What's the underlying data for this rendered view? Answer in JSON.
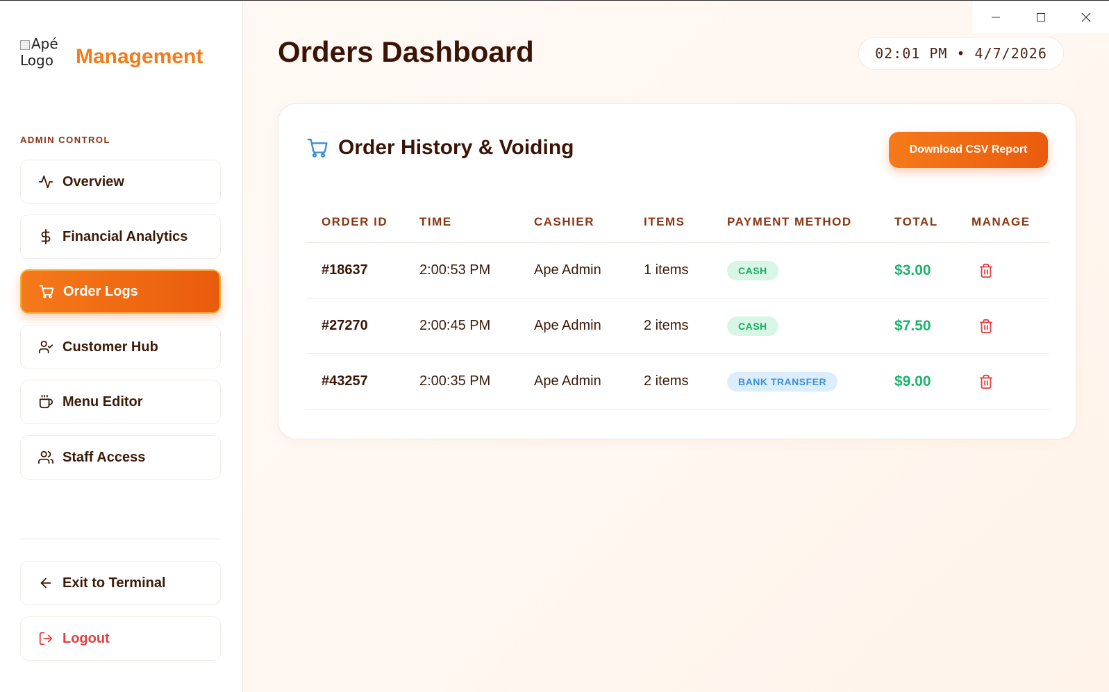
{
  "window": {
    "controls": [
      "minimize",
      "maximize",
      "close"
    ]
  },
  "sidebar": {
    "logo_alt_line1": "Apé",
    "logo_alt_line2": "Logo",
    "brand": "Management",
    "section_label": "ADMIN CONTROL",
    "items": [
      {
        "label": "Overview",
        "icon": "activity-icon"
      },
      {
        "label": "Financial Analytics",
        "icon": "dollar-icon"
      },
      {
        "label": "Order Logs",
        "icon": "cart-icon",
        "active": true
      },
      {
        "label": "Customer Hub",
        "icon": "user-check-icon"
      },
      {
        "label": "Menu Editor",
        "icon": "coffee-icon"
      },
      {
        "label": "Staff Access",
        "icon": "users-icon"
      }
    ],
    "exit_label": "Exit to Terminal",
    "logout_label": "Logout"
  },
  "header": {
    "title": "Orders Dashboard",
    "clock": "02:01 PM • 4/7/2026"
  },
  "card": {
    "title": "Order History & Voiding",
    "download_label": "Download CSV Report",
    "columns": [
      "ORDER ID",
      "TIME",
      "CASHIER",
      "ITEMS",
      "PAYMENT METHOD",
      "TOTAL",
      "MANAGE"
    ],
    "rows": [
      {
        "id": "#18637",
        "time": "2:00:53 PM",
        "cashier": "Ape Admin",
        "items": "1 items",
        "payment": "CASH",
        "total": "$3.00"
      },
      {
        "id": "#27270",
        "time": "2:00:45 PM",
        "cashier": "Ape Admin",
        "items": "2 items",
        "payment": "CASH",
        "total": "$7.50"
      },
      {
        "id": "#43257",
        "time": "2:00:35 PM",
        "cashier": "Ape Admin",
        "items": "2 items",
        "payment": "BANK TRANSFER",
        "total": "$9.00"
      }
    ]
  },
  "colors": {
    "accent": "#f07c1b",
    "accent_dark": "#ea5b0d",
    "success": "#19b36b",
    "danger": "#e23e3e",
    "info": "#3b8fd6"
  }
}
